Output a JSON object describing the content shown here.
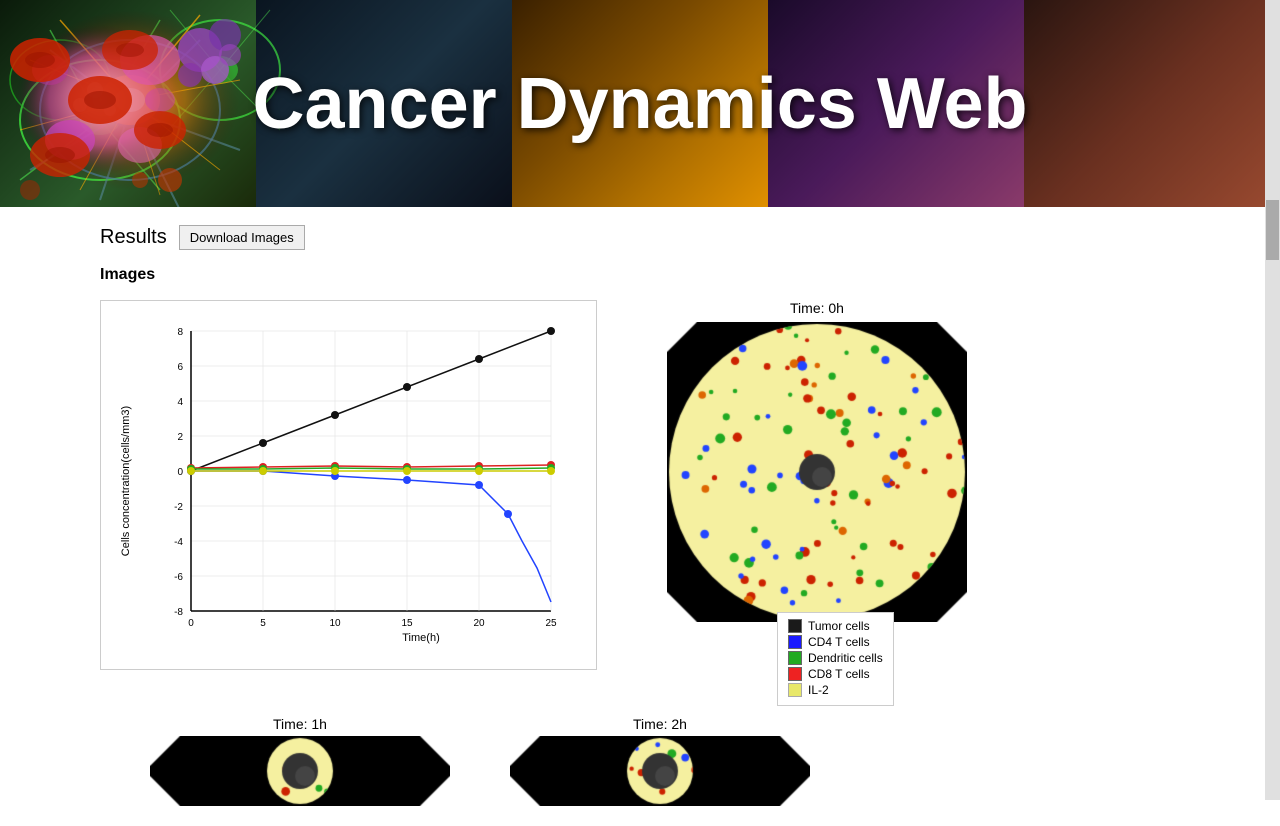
{
  "header": {
    "title": "Cancer Dynamics Web"
  },
  "results": {
    "title": "Results",
    "download_button": "Download Images",
    "images_section": "Images"
  },
  "chart": {
    "y_label": "Cells concentration(cells/mm3)",
    "x_label": "Time(h)",
    "y_ticks": [
      "8",
      "6",
      "4",
      "2",
      "0",
      "-2",
      "-4",
      "-6",
      "-8"
    ],
    "x_ticks": [
      "0",
      "5",
      "10",
      "15",
      "20",
      "25"
    ]
  },
  "simulation": {
    "time0_label": "Time: 0h",
    "time1_label": "Time: 1h",
    "time2_label": "Time: 2h"
  },
  "legend": {
    "items": [
      {
        "label": "Tumor cells",
        "color": "#1a1a1a"
      },
      {
        "label": "CD4 T cells",
        "color": "#1a1aff"
      },
      {
        "label": "Dendritic cells",
        "color": "#22aa22"
      },
      {
        "label": "CD8 T cells",
        "color": "#ee2222"
      },
      {
        "label": "IL-2",
        "color": "#e8e86a"
      }
    ]
  }
}
